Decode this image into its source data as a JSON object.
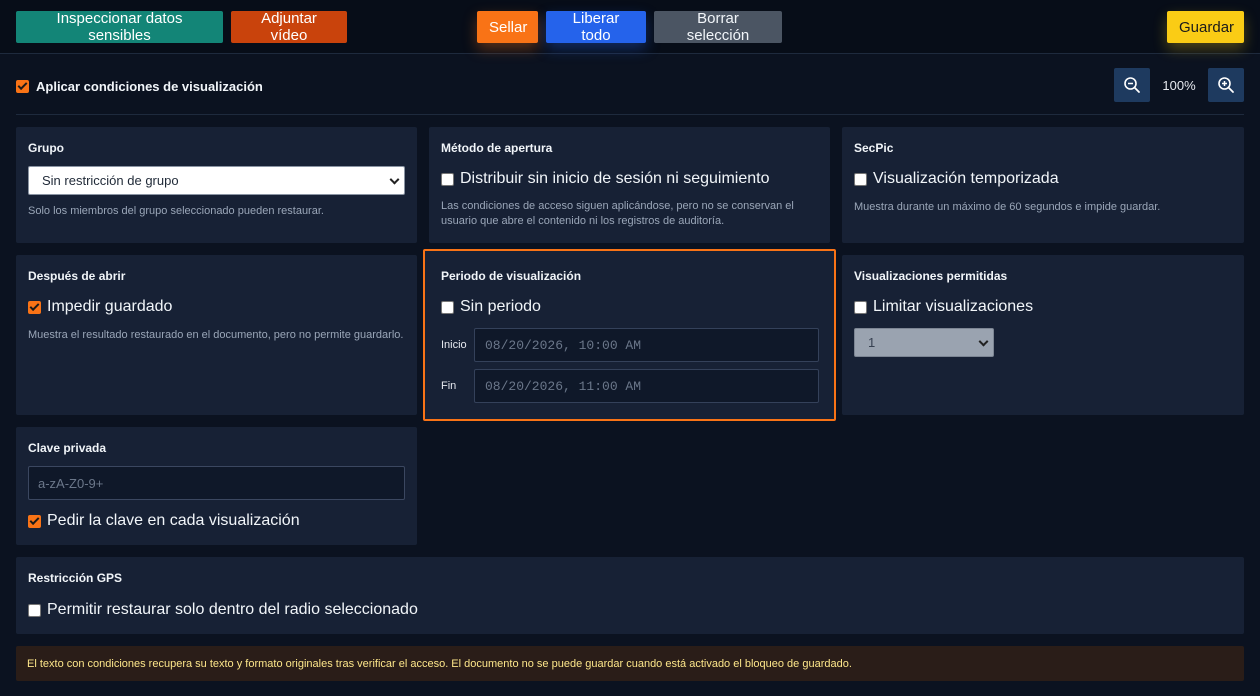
{
  "toolbar": {
    "inspect_label": "Inspeccionar datos sensibles",
    "attach_video_label": "Adjuntar vídeo",
    "seal_label": "Sellar",
    "release_all_label": "Liberar todo",
    "clear_selection_label": "Borrar selección",
    "save_label": "Guardar"
  },
  "conditions": {
    "apply_label": "Aplicar condiciones de visualización",
    "apply_checked": true,
    "zoom": "100%"
  },
  "group": {
    "title": "Grupo",
    "selected": "Sin restricción de grupo",
    "help": "Solo los miembros del grupo seleccionado pueden restaurar."
  },
  "open_method": {
    "title": "Método de apertura",
    "option_label": "Distribuir sin inicio de sesión ni seguimiento",
    "checked": false,
    "help_line1": "Las condiciones de acceso siguen aplicándose, pero no se conservan el",
    "help_line2": "usuario que abre el contenido ni los registros de auditoría."
  },
  "secpic": {
    "title": "SecPic",
    "option_label": "Visualización temporizada",
    "checked": false,
    "help": "Muestra durante un máximo de 60 segundos e impide guardar."
  },
  "after_open": {
    "title": "Después de abrir",
    "option_label": "Impedir guardado",
    "checked": true,
    "help": "Muestra el resultado restaurado en el documento, pero no permite guardarlo."
  },
  "view_period": {
    "title": "Periodo de visualización",
    "option_label": "Sin periodo",
    "checked": false,
    "start_label": "Inicio",
    "start_value": "08/20/2026, 10:00 AM",
    "end_label": "Fin",
    "end_value": "08/20/2026, 11:00 AM",
    "highlight_color": "#f97316"
  },
  "allowed_views": {
    "title": "Visualizaciones permitidas",
    "option_label": "Limitar visualizaciones",
    "checked": false,
    "selected": "1"
  },
  "private_key": {
    "title": "Clave privada",
    "placeholder": "a-zA-Z0-9+",
    "option_label": "Pedir la clave en cada visualización",
    "checked": true
  },
  "gps": {
    "title": "Restricción GPS",
    "option_label": "Permitir restaurar solo dentro del radio seleccionado",
    "checked": false
  },
  "notice": "El texto con condiciones recupera su texto y formato originales tras verificar el acceso. El documento no se puede guardar cuando está activado el bloqueo de guardado.",
  "icons": {
    "zoom_out": "zoom-out-icon",
    "zoom_in": "zoom-in-icon",
    "checkbox_checked": "checkbox-checked-icon"
  },
  "colors": {
    "accent": "#f97316",
    "inspect": "#138577",
    "attach_video": "#c9430c",
    "release_all": "#2563eb",
    "clear_selection": "#4b5563",
    "save": "#facc15"
  }
}
